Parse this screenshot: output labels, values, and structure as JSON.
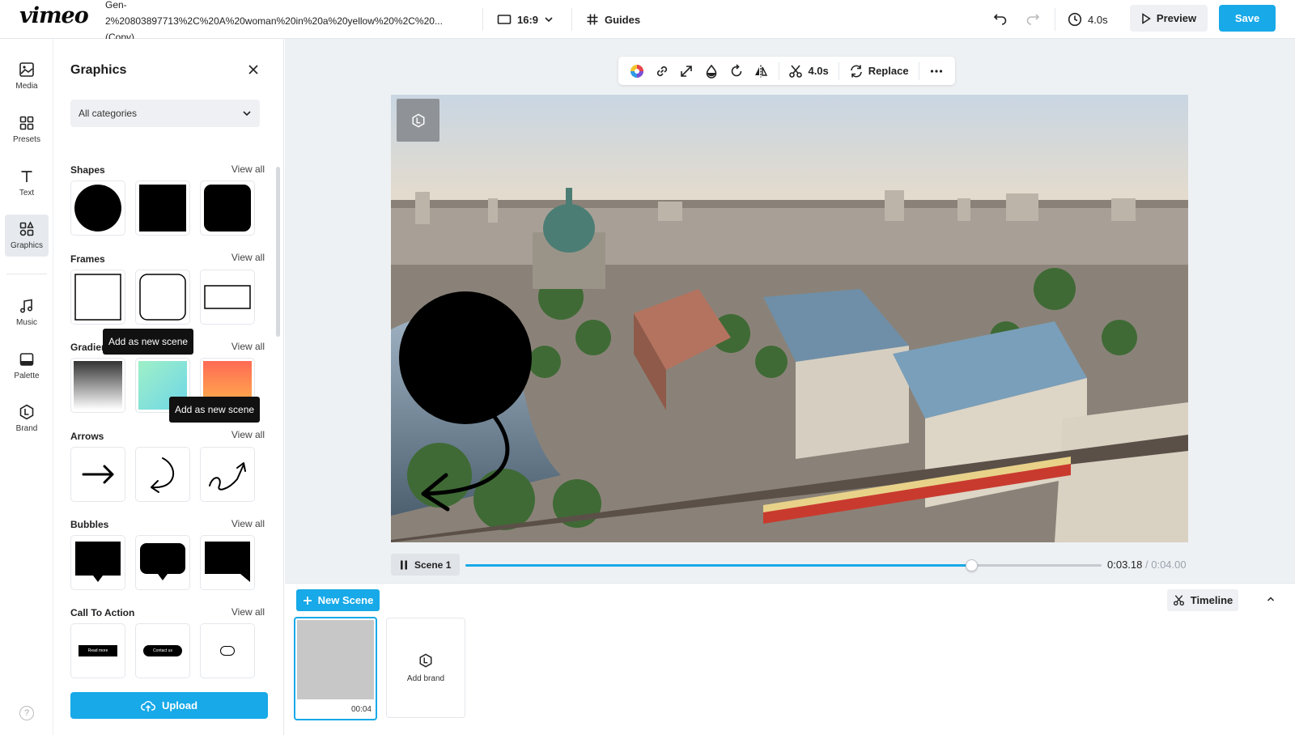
{
  "header": {
    "logo": "vimeo",
    "filename_lines": [
      "Gen-",
      "2%20803897713%2C%20A%20woman%20in%20a%20yellow%20%2C%20...",
      "(Copy)"
    ],
    "aspect_ratio": "16:9",
    "guides_label": "Guides",
    "duration": "4.0s",
    "preview_label": "Preview",
    "save_label": "Save"
  },
  "rail": {
    "items": [
      {
        "label": "Media",
        "icon": "image-icon"
      },
      {
        "label": "Presets",
        "icon": "grid-icon"
      },
      {
        "label": "Text",
        "icon": "text-icon"
      },
      {
        "label": "Graphics",
        "icon": "shapes-icon",
        "active": true
      },
      {
        "label": "Music",
        "icon": "music-icon"
      },
      {
        "label": "Palette",
        "icon": "palette-icon"
      },
      {
        "label": "Brand",
        "icon": "brand-icon"
      }
    ],
    "help_label": "?"
  },
  "panel": {
    "title": "Graphics",
    "category_select": "All categories",
    "view_all_label": "View all",
    "sections": [
      {
        "title": "Shapes"
      },
      {
        "title": "Frames"
      },
      {
        "title": "Gradients"
      },
      {
        "title": "Arrows"
      },
      {
        "title": "Bubbles"
      },
      {
        "title": "Call To Action"
      }
    ],
    "cta_texts": [
      "Read more",
      "Contact us"
    ],
    "tooltip": "Add as new scene",
    "upload_label": "Upload"
  },
  "toolbar": {
    "trim_duration": "4.0s",
    "replace_label": "Replace"
  },
  "player": {
    "scene_label": "Scene 1",
    "current_time": "0:03.18",
    "total_time": "/ 0:04.00",
    "progress_fraction": 0.795
  },
  "scenes": {
    "new_scene_label": "New Scene",
    "timeline_label": "Timeline",
    "scene_duration": "00:04",
    "add_brand_label": "Add brand"
  },
  "colors": {
    "accent": "#17a9e8",
    "canvas_bg": "#eef1f4"
  }
}
